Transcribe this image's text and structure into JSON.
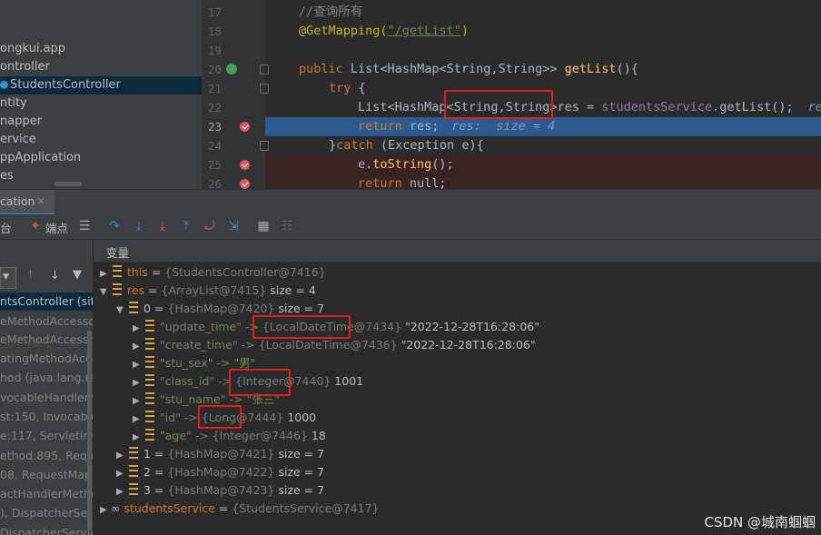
{
  "project_tree": [
    {
      "label": "ongkui.app",
      "selected": false
    },
    {
      "label": "ontroller",
      "selected": false
    },
    {
      "label": "StudentsController",
      "selected": true
    },
    {
      "label": "ntity",
      "selected": false
    },
    {
      "label": "napper",
      "selected": false
    },
    {
      "label": "ervice",
      "selected": false
    },
    {
      "label": "ppApplication",
      "selected": false
    },
    {
      "label": "es",
      "selected": false
    }
  ],
  "editor": {
    "line_numbers": [
      "17",
      "18",
      "19",
      "20",
      "21",
      "22",
      "23",
      "24",
      "25",
      "26"
    ],
    "comment": "//查询所有",
    "annotation": "@GetMapping(",
    "annotation_path": "\"/getList\"",
    "annotation_close": ")",
    "line20": {
      "kw": "public",
      "type": "List<HashMap<String,String>>",
      "method": "getList",
      "rest": "(){"
    },
    "line21": {
      "kw": "try",
      "rest": " {"
    },
    "line22": {
      "a": "List<HashMap",
      "b": "<String,String>",
      "c": "res",
      "d": " = ",
      "e": "studentsService",
      "f": ".getList();",
      "hint": "re"
    },
    "line23": {
      "kw": "return",
      "rest": " res;",
      "hint": "res:  size = 4"
    },
    "line24": {
      "a": "}",
      "kw": "catch",
      "rest": " (Exception e){"
    },
    "line25": {
      "a": "e.",
      "meth": "toString",
      "rest": "();"
    },
    "line26": {
      "kw": "return",
      "rest": " null;"
    }
  },
  "debug": {
    "tab_label": "cation",
    "tab_close": "×",
    "toolbar_labels": {
      "console": "台",
      "breakpoints": "端点"
    },
    "vars_header": "变量",
    "frames": [
      "ntsController (site",
      "eMethodAccesso",
      "eMethodAccesso",
      "atingMethodAcce",
      "hod (java.lang.refl",
      "vocableHandlerM",
      "st:150, InvocableH",
      "e:117, ServletInvo",
      "ethod:895, Reque",
      "08, RequestMappi",
      "actHandlerMethod",
      "), DispatcherServl",
      "DispatcherServlet /"
    ],
    "variables": [
      {
        "name": "this",
        "type": "{StudentsController@7416}",
        "value": ""
      },
      {
        "name": "res",
        "type": "{ArrayList@7415}",
        "value": "size = 4"
      },
      {
        "name": "0",
        "type": "{HashMap@7420}",
        "value": "size = 7"
      },
      {
        "key": "\"update_time\"",
        "type": "{LocalDateTime@7434}",
        "value": "\"2022-12-28T16:28:06\""
      },
      {
        "key": "\"create_time\"",
        "type": "{LocalDateTime@7436}",
        "value": "\"2022-12-28T16:28:06\""
      },
      {
        "key": "\"stu_sex\"",
        "type": "",
        "value": "\"男\""
      },
      {
        "key": "\"class_id\"",
        "type": "{Integer@7440}",
        "value": "1001"
      },
      {
        "key": "\"stu_name\"",
        "type": "",
        "value": "\"张三\""
      },
      {
        "key": "\"id\"",
        "type": "{Long@7444}",
        "value": "1000"
      },
      {
        "key": "\"age\"",
        "type": "{Integer@7446}",
        "value": "18"
      },
      {
        "name": "1",
        "type": "{HashMap@7421}",
        "value": "size = 7"
      },
      {
        "name": "2",
        "type": "{HashMap@7422}",
        "value": "size = 7"
      },
      {
        "name": "3",
        "type": "{HashMap@7423}",
        "value": "size = 7"
      },
      {
        "name": "studentsService",
        "type": "{StudentsService@7417}",
        "value": ""
      }
    ],
    "arrow_sep": " -> ",
    "eq_sep": " = "
  },
  "watermark": "CSDN @城南蝈蝈"
}
